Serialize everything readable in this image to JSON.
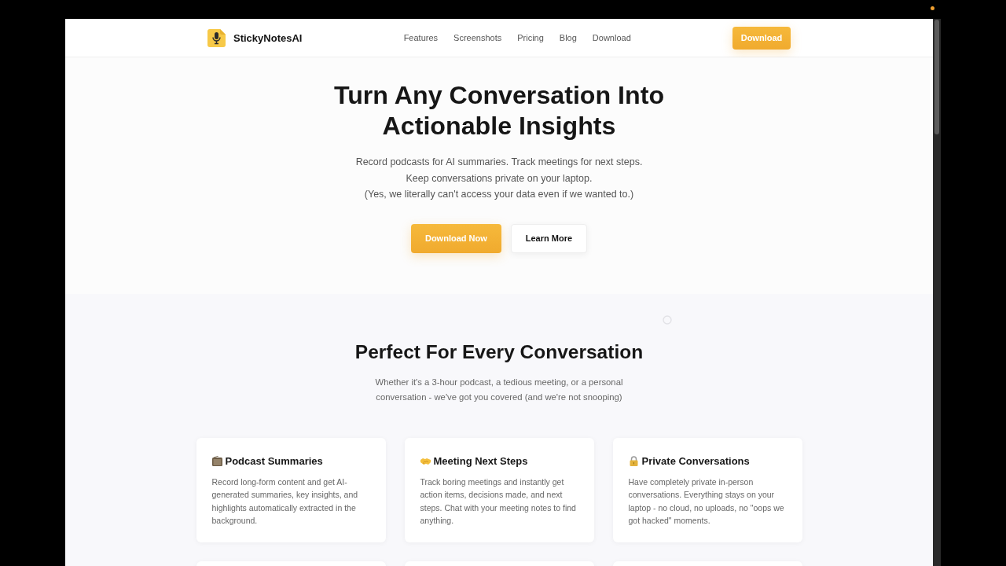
{
  "nav": {
    "brand": "StickyNotesAI",
    "links": [
      {
        "label": "Features"
      },
      {
        "label": "Screenshots"
      },
      {
        "label": "Pricing"
      },
      {
        "label": "Blog"
      },
      {
        "label": "Download"
      }
    ],
    "cta": "Download"
  },
  "hero": {
    "title": "Turn Any Conversation Into Actionable Insights",
    "subtitle_lines": [
      "Record podcasts for AI summaries. Track meetings for next steps.",
      "Keep conversations private on your laptop.",
      "(Yes, we literally can't access your data even if we wanted to.)"
    ],
    "buttons": [
      {
        "label": "Download Now",
        "kind": "primary"
      },
      {
        "label": "Learn More",
        "kind": "secondary"
      }
    ]
  },
  "features": {
    "title": "Perfect For Every Conversation",
    "subtitle": "Whether it's a 3-hour podcast, a tedious meeting, or a personal conversation - we've got you covered (and we're not snooping)",
    "cards": [
      {
        "title": "Podcast Summaries",
        "text": "Record long-form content and get AI-generated summaries, key insights, and highlights automatically extracted in the background."
      },
      {
        "title": "Meeting Next Steps",
        "text": "Track boring meetings and instantly get action items, decisions made, and next steps. Chat with your meeting notes to find anything."
      },
      {
        "title": "Private Conversations",
        "text": "Have completely private in-person conversations. Everything stays on your laptop - no cloud, no uploads, no \"oops we got hacked\" moments."
      }
    ]
  }
}
